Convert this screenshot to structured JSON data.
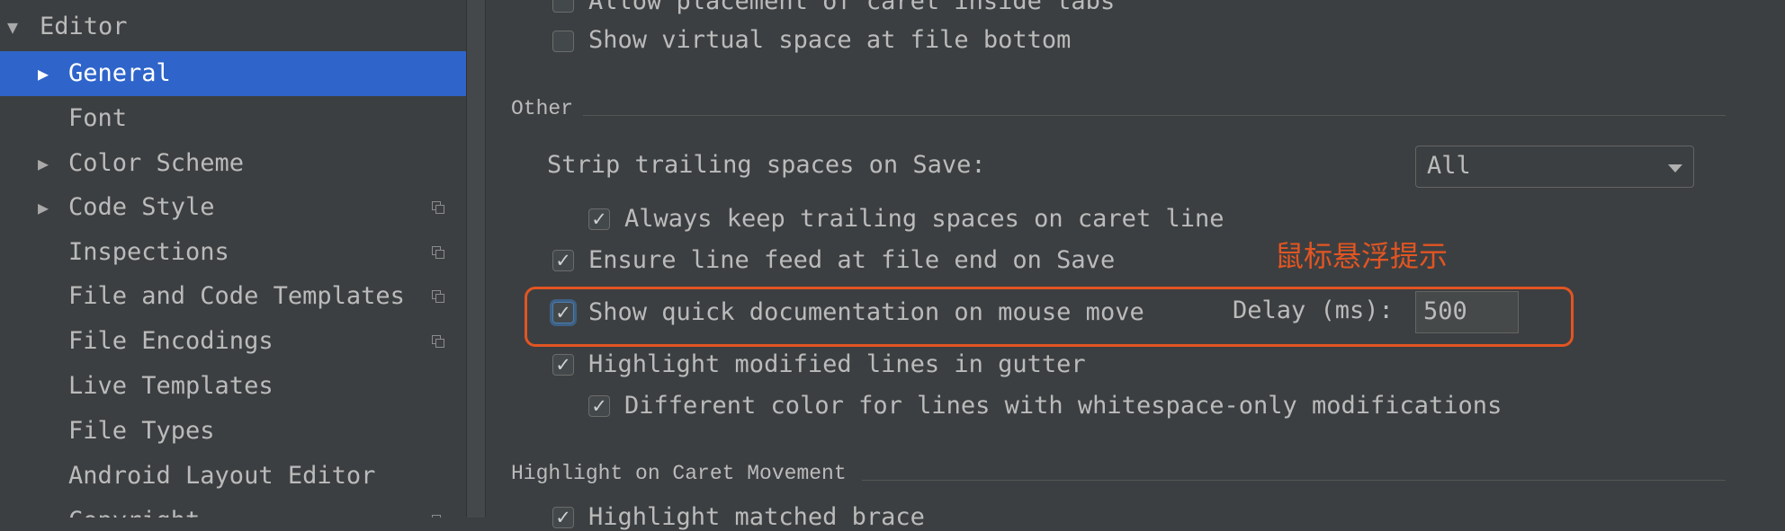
{
  "sidebar": {
    "header": "Editor",
    "items": [
      {
        "label": "General",
        "expandable": true,
        "selected": true,
        "scope_icon": false
      },
      {
        "label": "Font",
        "expandable": false,
        "selected": false,
        "scope_icon": false
      },
      {
        "label": "Color Scheme",
        "expandable": true,
        "selected": false,
        "scope_icon": false
      },
      {
        "label": "Code Style",
        "expandable": true,
        "selected": false,
        "scope_icon": true
      },
      {
        "label": "Inspections",
        "expandable": false,
        "selected": false,
        "scope_icon": true
      },
      {
        "label": "File and Code Templates",
        "expandable": false,
        "selected": false,
        "scope_icon": true
      },
      {
        "label": "File Encodings",
        "expandable": false,
        "selected": false,
        "scope_icon": true
      },
      {
        "label": "Live Templates",
        "expandable": false,
        "selected": false,
        "scope_icon": false
      },
      {
        "label": "File Types",
        "expandable": false,
        "selected": false,
        "scope_icon": false
      },
      {
        "label": "Android Layout Editor",
        "expandable": false,
        "selected": false,
        "scope_icon": false
      },
      {
        "label": "Copyright",
        "expandable": true,
        "selected": false,
        "scope_icon": true
      }
    ]
  },
  "content": {
    "top_options": [
      {
        "label": "Allow placement of caret inside tabs",
        "checked": false
      },
      {
        "label": "Show virtual space at file bottom",
        "checked": false
      }
    ],
    "other_section": {
      "title": "Other",
      "strip_label": "Strip trailing spaces on Save:",
      "strip_value": "All",
      "keep_trailing": {
        "label": "Always keep trailing spaces on caret line",
        "checked": true
      },
      "line_feed": {
        "label": "Ensure line feed at file end on Save",
        "checked": true
      },
      "quick_doc": {
        "label": "Show quick documentation on mouse move",
        "checked": true
      },
      "delay_label": "Delay (ms):",
      "delay_value": "500",
      "highlight_modified": {
        "label": "Highlight modified lines in gutter",
        "checked": true
      },
      "different_color": {
        "label": "Different color for lines with whitespace-only modifications",
        "checked": true
      }
    },
    "caret_section": {
      "title": "Highlight on Caret Movement",
      "matched_brace": {
        "label": "Highlight matched brace",
        "checked": true
      }
    }
  },
  "annotation": {
    "text": "鼠标悬浮提示",
    "color": "#e25522"
  },
  "colors": {
    "background": "#3c3f41",
    "selection": "#2f65ca",
    "text": "#bbbbbb"
  },
  "icons": {
    "checkmark": "checkmark-icon",
    "expand": "expand-arrow-icon",
    "scope": "project-scope-icon",
    "dropdown": "chevron-down-icon"
  }
}
